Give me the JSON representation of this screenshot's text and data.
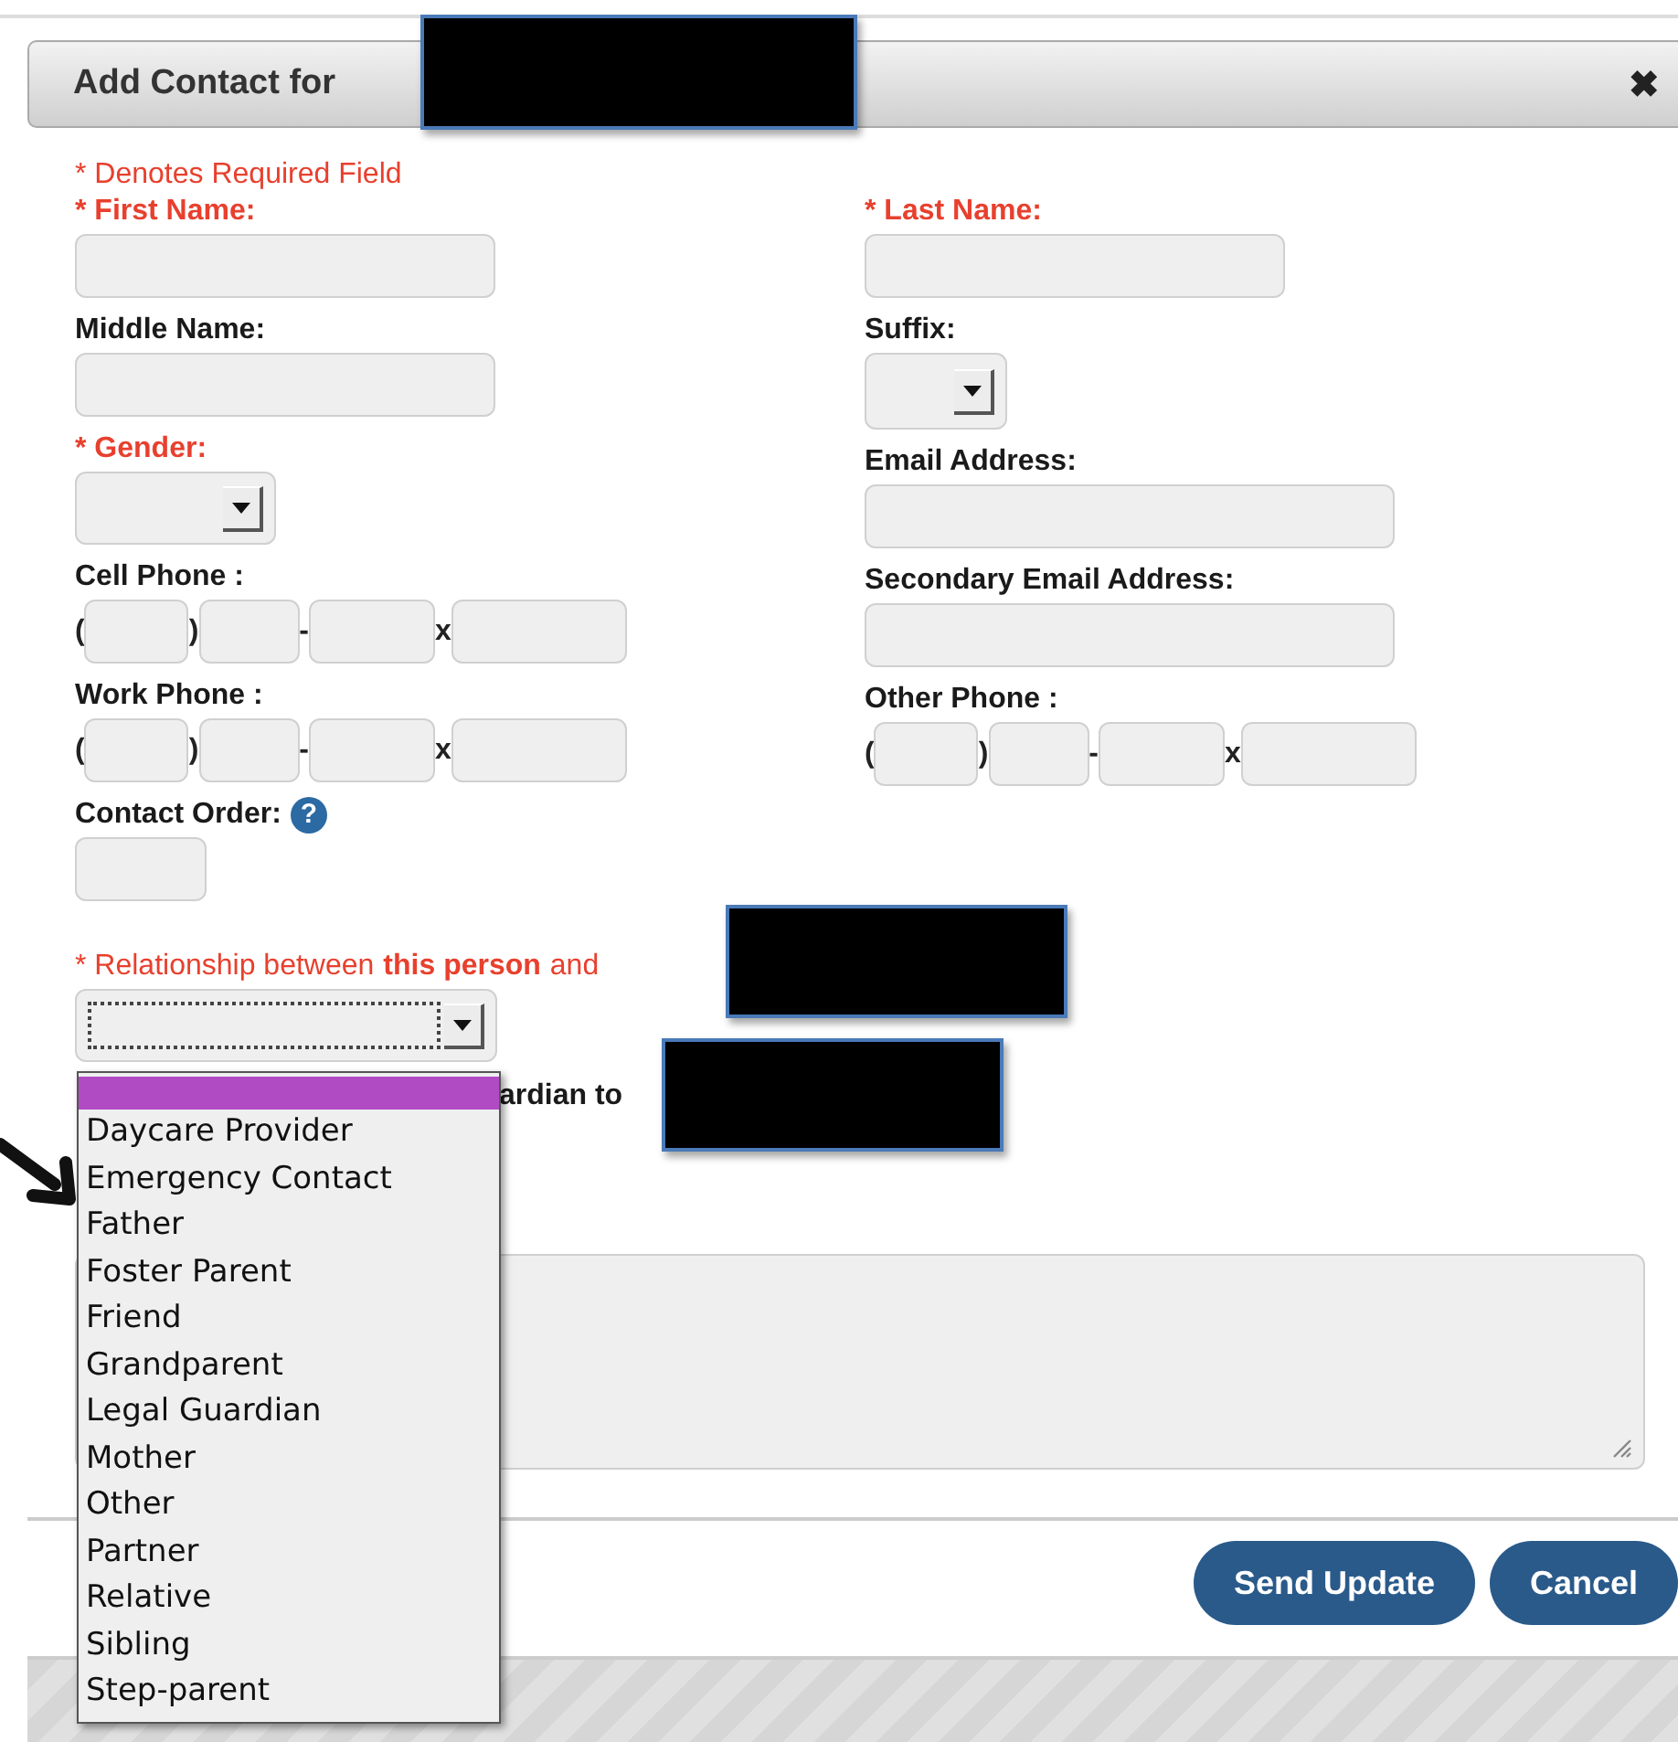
{
  "dialog": {
    "title": "Add Contact for",
    "close": "✖"
  },
  "required_note": "* Denotes Required Field",
  "left_fields": [
    {
      "kind": "text",
      "label": "* First Name:",
      "required": true
    },
    {
      "kind": "text",
      "label": "Middle Name:",
      "required": false
    },
    {
      "kind": "select",
      "label": "* Gender:",
      "required": true
    },
    {
      "kind": "phone",
      "label": "Cell Phone :",
      "required": false,
      "separators": [
        "(",
        ")",
        "-",
        "x"
      ]
    },
    {
      "kind": "phone",
      "label": "Work Phone :",
      "required": false,
      "separators": [
        "(",
        ")",
        "-",
        "x"
      ]
    },
    {
      "kind": "short",
      "label": "Contact Order:",
      "required": false,
      "help": "?"
    }
  ],
  "right_fields": [
    {
      "kind": "text",
      "label": "* Last Name:",
      "required": true
    },
    {
      "kind": "small-select",
      "label": "Suffix:",
      "required": false
    },
    {
      "kind": "wide",
      "label": "Email Address:",
      "required": false
    },
    {
      "kind": "wide",
      "label": "Secondary Email Address:",
      "required": false
    },
    {
      "kind": "phone",
      "label": "Other Phone :",
      "required": false,
      "separators": [
        "(",
        ")",
        "-",
        "x"
      ]
    }
  ],
  "relationship": {
    "label": "* Relationship between **this person** and",
    "focused": true,
    "blank_option_selected": true,
    "options": [
      {
        "label": "Daycare Provider",
        "selected": false
      },
      {
        "label": "Emergency Contact",
        "selected": false
      },
      {
        "label": "Father",
        "selected": false
      },
      {
        "label": "Foster Parent",
        "selected": false
      },
      {
        "label": "Friend",
        "selected": false
      },
      {
        "label": "Grandparent",
        "selected": false
      },
      {
        "label": "Legal Guardian",
        "selected": false
      },
      {
        "label": "Mother",
        "selected": false
      },
      {
        "label": "Other",
        "selected": false
      },
      {
        "label": "Partner",
        "selected": false
      },
      {
        "label": "Relative",
        "selected": false
      },
      {
        "label": "Sibling",
        "selected": false
      },
      {
        "label": "Step-parent",
        "selected": false
      }
    ]
  },
  "guardian_line": "ardian to",
  "buttons": [
    "Send Update",
    "Cancel"
  ]
}
